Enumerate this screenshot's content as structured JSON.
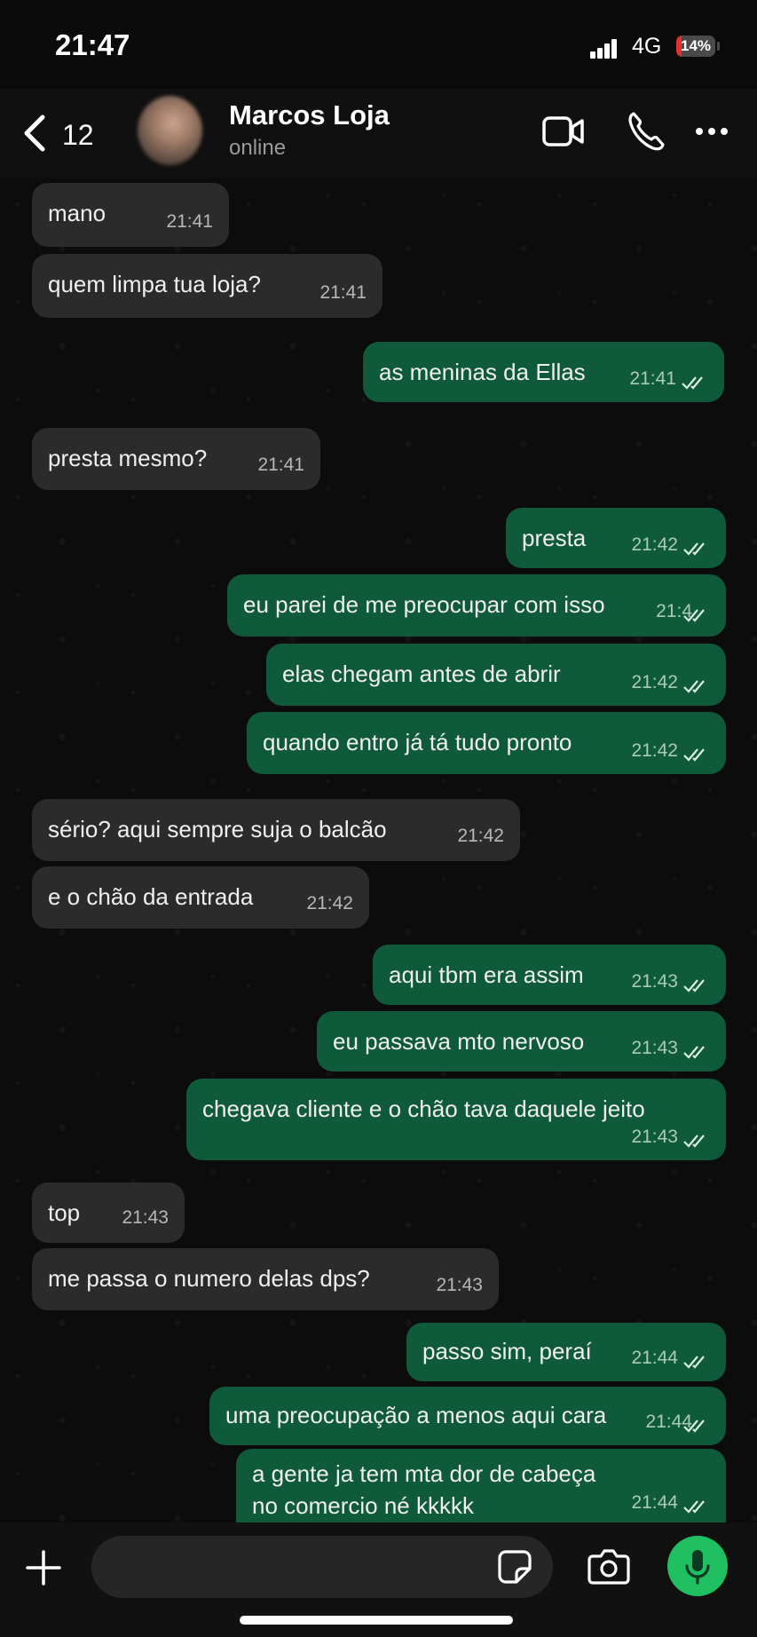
{
  "status_bar": {
    "time": "21:47",
    "network": "4G",
    "battery": "14%",
    "battery_level": 0.14
  },
  "header": {
    "back_count": "12",
    "contact_name": "Marcos Loja",
    "contact_status": "online"
  },
  "messages": [
    {
      "dir": "in",
      "text": "mano",
      "time": "21:41"
    },
    {
      "dir": "in",
      "text": "quem limpa tua loja?",
      "time": "21:41"
    },
    {
      "dir": "out",
      "text": "as meninas da Ellas",
      "time": "21:41"
    },
    {
      "dir": "in",
      "text": "presta mesmo?",
      "time": "21:41"
    },
    {
      "dir": "out",
      "text": "presta",
      "time": "21:42"
    },
    {
      "dir": "out",
      "text": "eu parei de me preocupar com isso",
      "time": "21:4"
    },
    {
      "dir": "out",
      "text": "elas chegam antes de abrir",
      "time": "21:42"
    },
    {
      "dir": "out",
      "text": "quando entro já tá tudo pronto",
      "time": "21:42"
    },
    {
      "dir": "in",
      "text": "sério? aqui sempre suja o balcão",
      "time": "21:42"
    },
    {
      "dir": "in",
      "text": "e o chão da entrada",
      "time": "21:42"
    },
    {
      "dir": "out",
      "text": "aqui tbm era assim",
      "time": "21:43"
    },
    {
      "dir": "out",
      "text": "eu passava mto nervoso",
      "time": "21:43"
    },
    {
      "dir": "out",
      "text": "chegava cliente e o chão tava daquele jeito",
      "time": "21:43"
    },
    {
      "dir": "in",
      "text": "top",
      "time": "21:43"
    },
    {
      "dir": "in",
      "text": "me passa o numero delas dps?",
      "time": "21:43"
    },
    {
      "dir": "out",
      "text": "passo sim, peraí",
      "time": "21:44"
    },
    {
      "dir": "out",
      "text": "uma preocupação a menos aqui cara",
      "time": "21:44"
    },
    {
      "dir": "out",
      "text": "a gente ja tem mta dor de cabeça",
      "text2": "no comercio né kkkkk",
      "time": "21:44"
    }
  ],
  "colors": {
    "incoming_bubble": "#2b2b2b",
    "outgoing_bubble": "#0f5a3a",
    "mic_button": "#1fbf62",
    "battery_low": "#e5302d"
  },
  "icons": [
    "chevron-left-icon",
    "video-call-icon",
    "phone-icon",
    "more-icon",
    "plus-icon",
    "sticker-icon",
    "camera-icon",
    "mic-icon",
    "double-check-icon"
  ]
}
